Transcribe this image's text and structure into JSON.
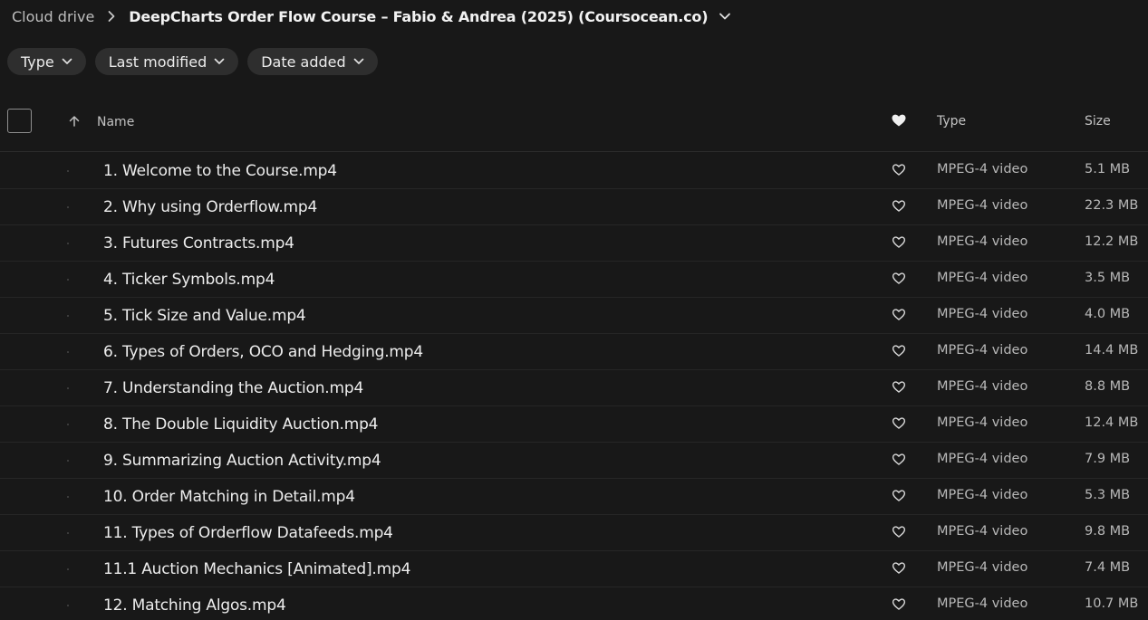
{
  "breadcrumb": {
    "root": "Cloud drive",
    "current": "DeepCharts Order Flow Course – Fabio & Andrea (2025) (Coursocean.co)"
  },
  "filters": [
    {
      "label": "Type"
    },
    {
      "label": "Last modified"
    },
    {
      "label": "Date added"
    }
  ],
  "columns": {
    "name": "Name",
    "type": "Type",
    "size": "Size"
  },
  "files": [
    {
      "name": "1. Welcome to the Course.mp4",
      "type": "MPEG-4 video",
      "size": "5.1 MB"
    },
    {
      "name": "2. Why using Orderflow.mp4",
      "type": "MPEG-4 video",
      "size": "22.3 MB"
    },
    {
      "name": "3. Futures Contracts.mp4",
      "type": "MPEG-4 video",
      "size": "12.2 MB"
    },
    {
      "name": "4. Ticker Symbols.mp4",
      "type": "MPEG-4 video",
      "size": "3.5 MB"
    },
    {
      "name": "5. Tick Size and Value.mp4",
      "type": "MPEG-4 video",
      "size": "4.0 MB"
    },
    {
      "name": "6. Types of Orders, OCO and Hedging.mp4",
      "type": "MPEG-4 video",
      "size": "14.4 MB"
    },
    {
      "name": "7. Understanding the Auction.mp4",
      "type": "MPEG-4 video",
      "size": "8.8 MB"
    },
    {
      "name": "8. The Double Liquidity Auction.mp4",
      "type": "MPEG-4 video",
      "size": "12.4 MB"
    },
    {
      "name": "9. Summarizing Auction Activity.mp4",
      "type": "MPEG-4 video",
      "size": "7.9 MB"
    },
    {
      "name": "10. Order Matching in Detail.mp4",
      "type": "MPEG-4 video",
      "size": "5.3 MB"
    },
    {
      "name": "11. Types of Orderflow Datafeeds.mp4",
      "type": "MPEG-4 video",
      "size": "9.8 MB"
    },
    {
      "name": "11.1 Auction Mechanics [Animated].mp4",
      "type": "MPEG-4 video",
      "size": "7.4 MB"
    },
    {
      "name": "12. Matching Algos.mp4",
      "type": "MPEG-4 video",
      "size": "10.7 MB"
    }
  ],
  "icons": {
    "breadcrumb_separator": "chevron-right-icon",
    "folder_menu": "chevron-down-icon",
    "sort": "arrow-up-icon",
    "favorites_header": "heart-filled-icon",
    "favorite": "heart-outline-icon"
  },
  "colors": {
    "background": "#181818",
    "chip": "#2e2e2e",
    "text_primary": "#ededed",
    "text_secondary": "#b8b8b8"
  }
}
